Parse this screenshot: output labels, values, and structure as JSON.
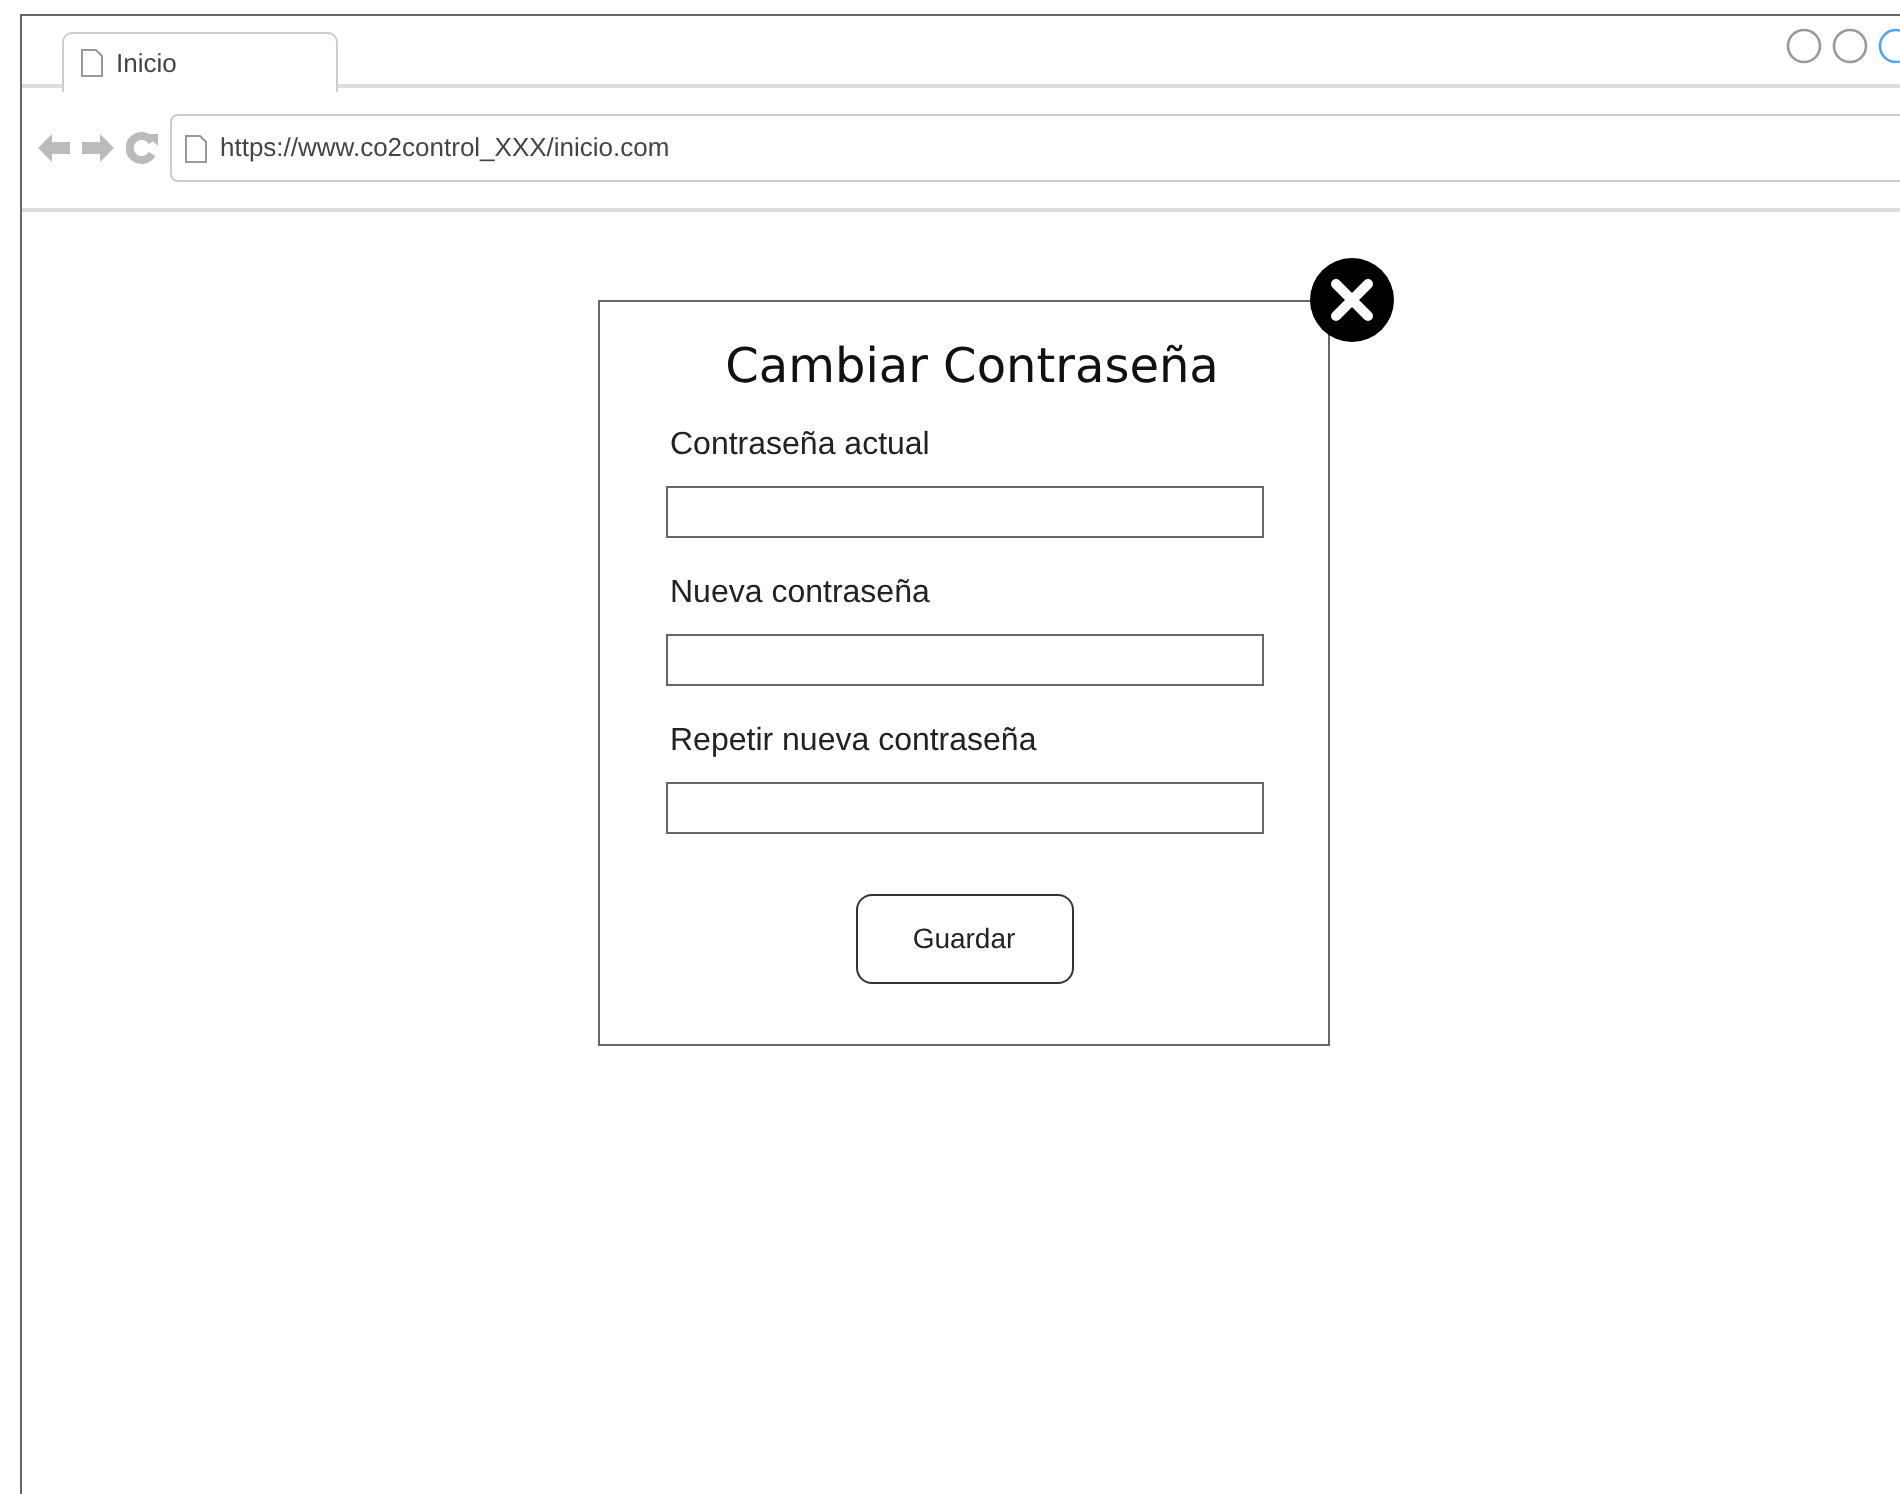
{
  "browser": {
    "tab": {
      "label": "Inicio"
    },
    "url": "https://www.co2control_XXX/inicio.com"
  },
  "dialog": {
    "title": "Cambiar Contraseña",
    "fields": [
      {
        "label": "Contraseña actual"
      },
      {
        "label": "Nueva contraseña"
      },
      {
        "label": "Repetir nueva contraseña"
      }
    ],
    "button": "Guardar"
  }
}
